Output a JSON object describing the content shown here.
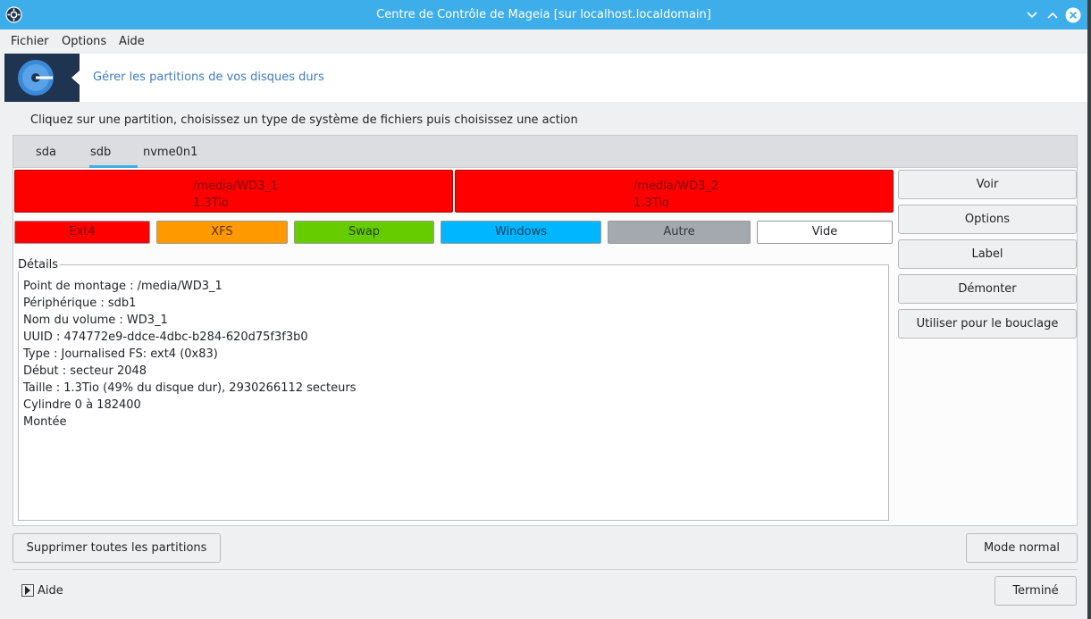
{
  "window": {
    "title": "Centre de Contrôle de Mageia [sur localhost.localdomain]"
  },
  "menu": [
    "Fichier",
    "Options",
    "Aide"
  ],
  "header": {
    "subtitle": "Gérer les partitions de vos disques durs"
  },
  "instructions": "Cliquez sur une partition, choisissez un type de système de fichiers puis choisissez une action",
  "tabs": [
    {
      "label": "sda",
      "selected": false
    },
    {
      "label": "sdb",
      "selected": true
    },
    {
      "label": "nvme0n1",
      "selected": false
    }
  ],
  "partitions": [
    {
      "mount": "/media/WD3_1",
      "size": "1.3Tio",
      "color": "#ff0000"
    },
    {
      "mount": "/media/WD3_2",
      "size": "1.3Tio",
      "color": "#ff0000"
    }
  ],
  "fs_types": [
    {
      "label": "Ext4",
      "color": "#ff0000"
    },
    {
      "label": "XFS",
      "color": "#ff9900"
    },
    {
      "label": "Swap",
      "color": "#66cc00"
    },
    {
      "label": "Windows",
      "color": "#00b7ff"
    },
    {
      "label": "Autre",
      "color": "#a3a9ae"
    },
    {
      "label": "Vide",
      "color": "#ffffff"
    }
  ],
  "details": {
    "title": "Détails",
    "lines": [
      "Point de montage : /media/WD3_1",
      "Périphérique : sdb1",
      "Nom du volume : WD3_1",
      "UUID : 474772e9-ddce-4dbc-b284-620d75f3f3b0",
      "Type : Journalised FS: ext4 (0x83)",
      "Début : secteur 2048",
      "Taille : 1.3Tio (49% du disque dur), 2930266112 secteurs",
      "Cylindre 0 à 182400",
      "Montée"
    ]
  },
  "actions": [
    "Voir",
    "Options",
    "Label",
    "Démonter",
    "Utiliser pour le bouclage"
  ],
  "bottom": {
    "delete_all": "Supprimer toutes les partitions",
    "mode": "Mode normal",
    "help": "Aide",
    "done": "Terminé"
  }
}
